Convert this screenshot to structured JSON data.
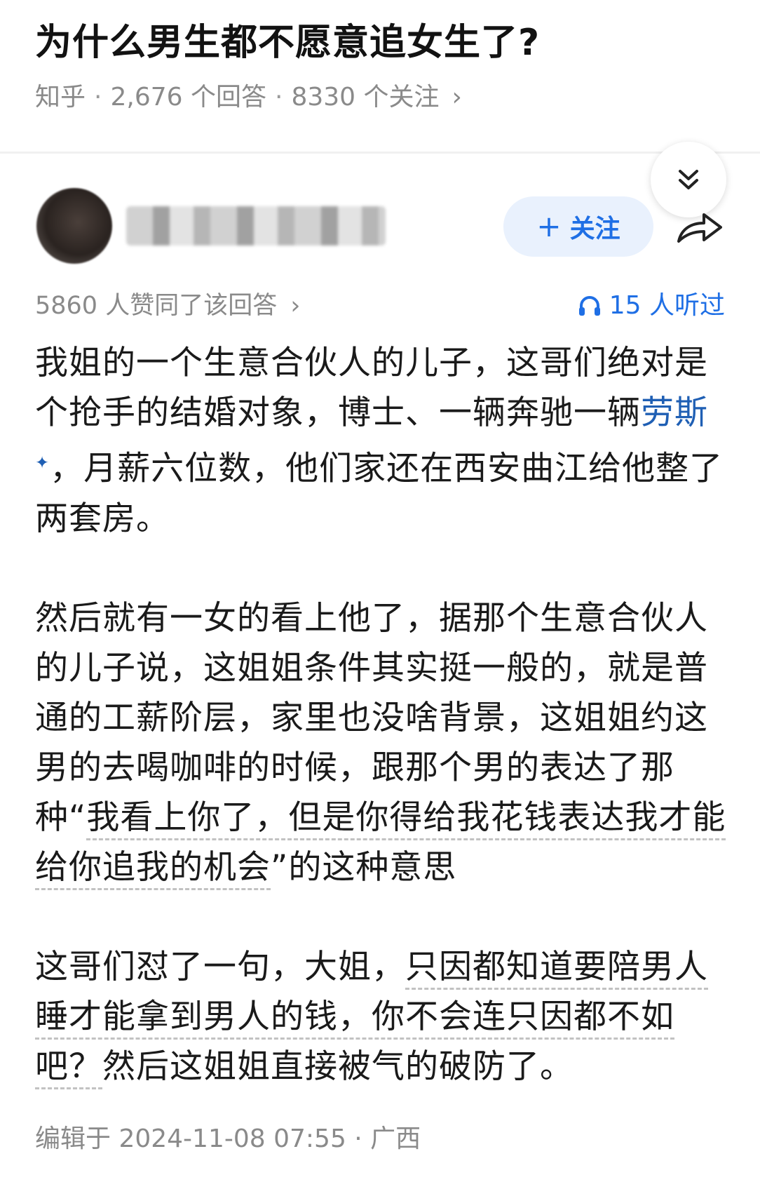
{
  "question": {
    "title": "为什么男生都不愿意追女生了?",
    "source": "知乎",
    "answers": "2,676 个回答",
    "followers": "8330 个关注"
  },
  "follow_button": {
    "label": "关注"
  },
  "stats": {
    "upvotes": "5860 人赞同了该回答",
    "listens": "15 人听过"
  },
  "answer": {
    "p1_a": "我姐的一个生意合伙人的儿子，这哥们绝对是个抢手的结婚对象，博士、一辆奔驰一辆",
    "p1_link": "劳斯",
    "p1_b": "，月薪六位数，他们家还在西安曲江给他整了两套房。",
    "p2_a": "然后就有一女的看上他了，据那个生意合伙人的儿子说，这姐姐条件其实挺一般的，就是普通的工薪阶层，家里也没啥背景，这姐姐约这男的去喝咖啡的时候，跟那个男的表达了那种“",
    "p2_hl": "我看上你了，但是你得给我花钱表达我才能给你追我的机会",
    "p2_b": "”的这种意思",
    "p3_a": "这哥们怼了一句，大姐，",
    "p3_hl": "只因都知道要陪男人睡才能拿到男人的钱，你不会连只因都不如吧？",
    "p3_b": "然后这姐姐直接被气的破防了。"
  },
  "footer": {
    "edited": "编辑于 2024-11-08 07:55 · 广西"
  },
  "icons": {
    "collapse": "double-chevron-down-icon",
    "share": "share-arrow-icon",
    "headphones": "headphones-icon",
    "more": "chevron-right-icon"
  },
  "colors": {
    "accent": "#1f6fe5",
    "link": "#1f5fb4",
    "muted": "#8a8a8a"
  }
}
